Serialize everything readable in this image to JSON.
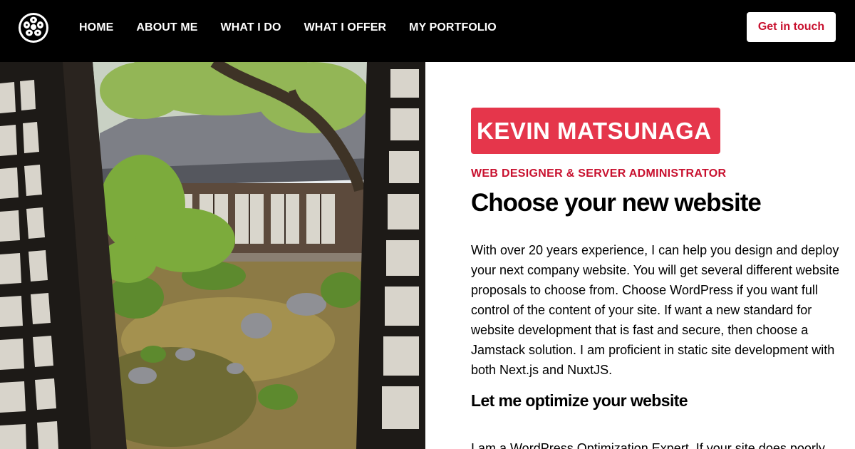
{
  "header": {
    "logo_icon": "family-crest-icon",
    "nav": [
      {
        "label": "HOME"
      },
      {
        "label": "ABOUT ME"
      },
      {
        "label": "WHAT I DO"
      },
      {
        "label": "WHAT I OFFER"
      },
      {
        "label": "MY PORTFOLIO"
      }
    ],
    "cta_label": "Get in touch"
  },
  "hero": {
    "image_icon": "japanese-garden-photo",
    "name": "KEVIN MATSUNAGA",
    "subtitle": "WEB DESIGNER & SERVER ADMINISTRATOR",
    "title": "Choose your new website",
    "paragraph": "With over 20 years experience, I can help you design and deploy your next company website. You will get several different website proposals to choose from. Choose WordPress if you want full control of the content of your site. If want a new standard for website development that is fast and secure, then choose a Jamstack solution. I am proficient in static site development with both Next.js and NuxtJS.",
    "section_title": "Let me optimize your website",
    "paragraph2": "I am a WordPress Optimization Expert. If your site does poorly"
  },
  "colors": {
    "header_bg": "#000000",
    "accent_red": "#c8102e",
    "badge_red": "#e5364b"
  }
}
